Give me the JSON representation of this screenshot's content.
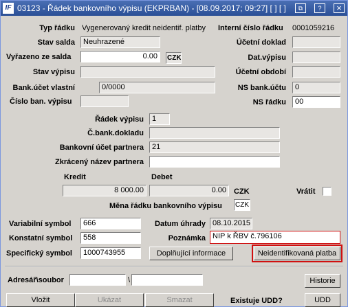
{
  "window": {
    "title": "03123 - Řádek bankovního výpisu (EKPRBAN) - [08.09.2017; 09:27] [ ] [ ]",
    "icon_text": "IF",
    "btn_restore": "⧉",
    "btn_help": "?",
    "btn_close": "×"
  },
  "labels": {
    "typ_radku": "Typ řádku",
    "stav_salda": "Stav salda",
    "vyrazeno_ze_salda": "Vyřazeno ze salda",
    "stav_vypisu": "Stav výpisu",
    "bank_ucet_vlastni": "Bank.účet vlastní",
    "cislo_ban_vypisu": "Číslo ban. výpisu",
    "interni_cislo_radku": "Interní číslo řádku",
    "ucetni_doklad": "Účetní doklad",
    "dat_vypisu": "Dat.výpisu",
    "ucetni_obdobi": "Účetní období",
    "ns_bank_uctu": "NS bank.účtu",
    "ns_radku": "NS řádku",
    "radek_vypisu": "Řádek výpisu",
    "c_bank_dokladu": "Č.bank.dokladu",
    "bankovni_ucet_partnera": "Bankovní účet partnera",
    "zkraceny_nazev_partnera": "Zkrácený název partnera",
    "kredit": "Kredit",
    "debet": "Debet",
    "czk_amount": "CZK",
    "vratit": "Vrátit",
    "mena_radku": "Měna řádku bankovního výpisu",
    "variabilni_symbol": "Variabilní symbol",
    "konstatni_symbol": "Konstatní symbol",
    "specificky_symbol": "Specifický symbol",
    "datum_uhrady": "Datum úhrady",
    "poznamka": "Poznámka",
    "adresar_soubor": "Adresář\\soubor",
    "path_sep": "\\",
    "existuje_udd": "Existuje UDD?"
  },
  "values": {
    "typ_radku": "Vygenerovaný kredit neidentif. platby",
    "stav_salda": "Neuhrazené",
    "vyrazeno_ze_salda": "0.00",
    "vyrazeno_currency": "CZK",
    "stav_vypisu": "",
    "bank_ucet_vlastni": "0/0000",
    "cislo_ban_vypisu": "",
    "interni_cislo_radku": "0001059216",
    "ucetni_doklad": "",
    "dat_vypisu": "",
    "ucetni_obdobi": "",
    "ns_bank_uctu": "0",
    "ns_radku": "00",
    "radek_vypisu": "1",
    "c_bank_dokladu": "",
    "bankovni_ucet_partnera": "21",
    "zkraceny_nazev_partnera": "",
    "kredit": "8 000.00",
    "debet": "0.00",
    "mena_radku": "CZK",
    "variabilni_symbol": "666",
    "konstatni_symbol": "558",
    "specificky_symbol": "1000743955",
    "datum_uhrady": "08.10.2015",
    "poznamka": "NIP k ŘBV č.796106",
    "adresar": "",
    "soubor": ""
  },
  "buttons": {
    "doplnujici_informace": "Doplňující informace",
    "neidentifikovana_platba": "Neidentifikovaná platba",
    "historie": "Historie",
    "vlozit": "Vložit",
    "ukazat": "Ukázat",
    "smazat": "Smazat",
    "udd": "UDD"
  },
  "colors": {
    "highlight": "#d01010",
    "title_bar": "#3a5fa6",
    "panel": "#d6d3ce"
  }
}
